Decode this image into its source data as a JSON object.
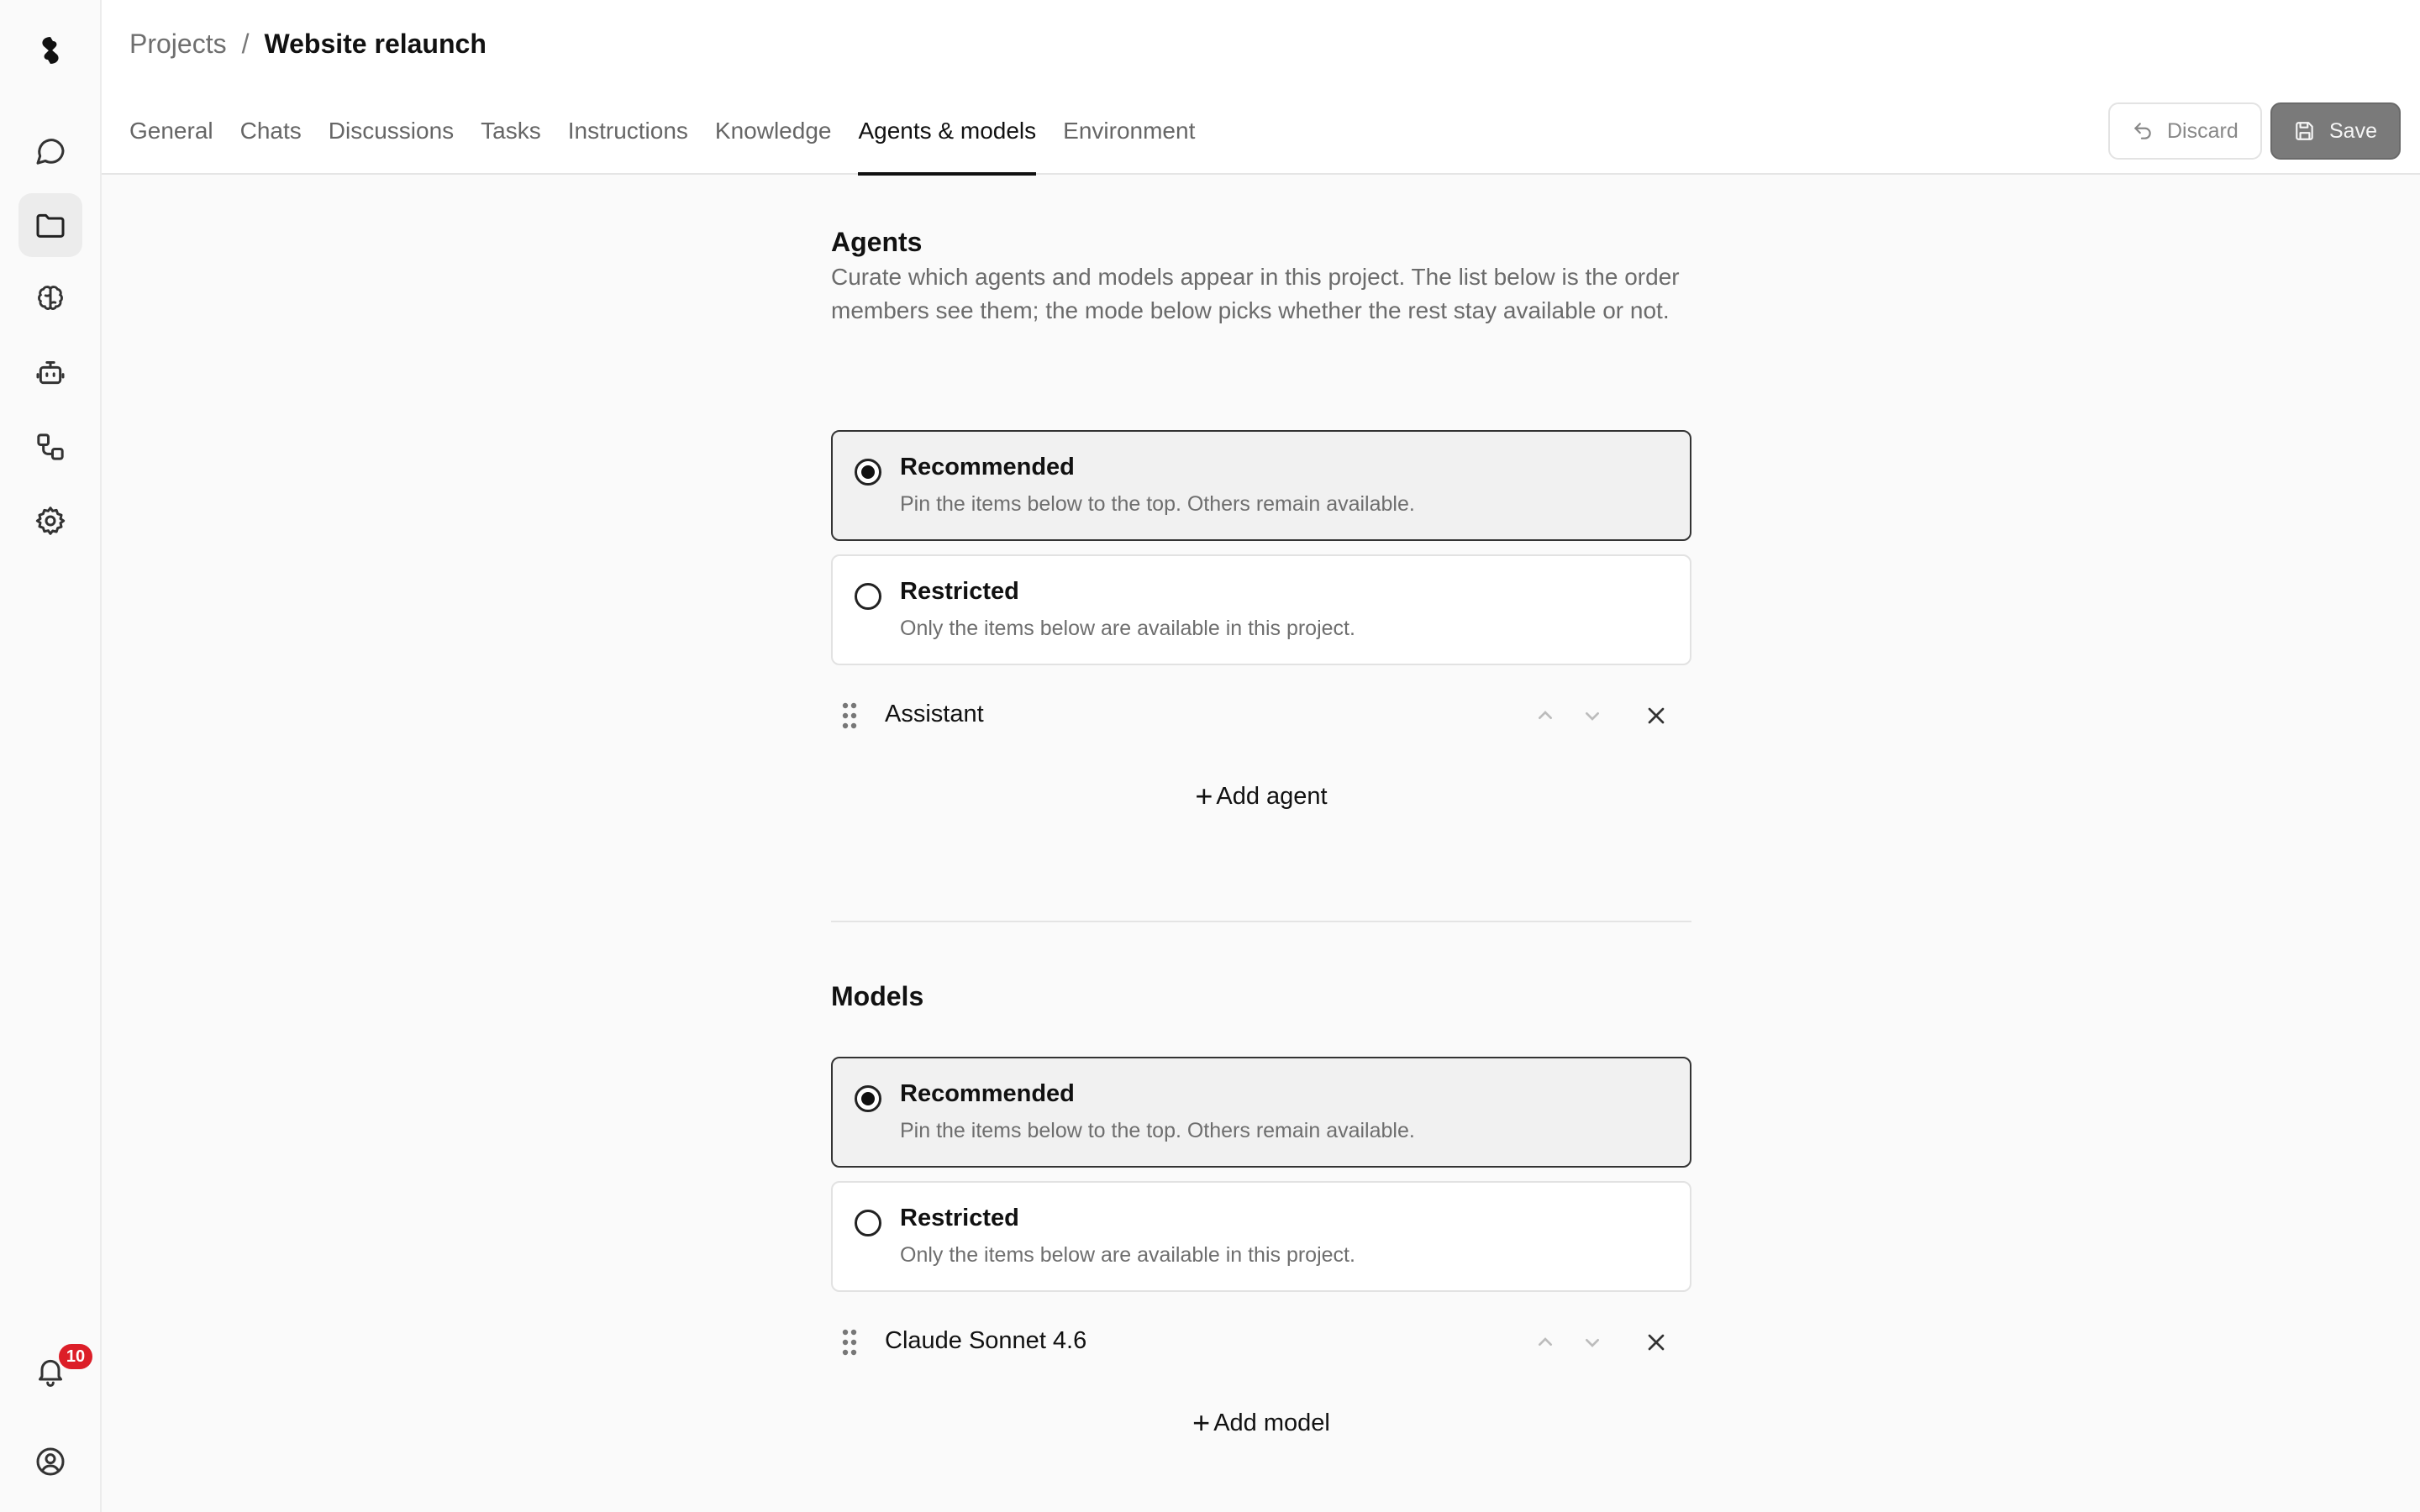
{
  "breadcrumb": {
    "parent": "Projects",
    "separator": "/",
    "current": "Website relaunch"
  },
  "tabs": [
    {
      "label": "General"
    },
    {
      "label": "Chats"
    },
    {
      "label": "Discussions"
    },
    {
      "label": "Tasks"
    },
    {
      "label": "Instructions"
    },
    {
      "label": "Knowledge"
    },
    {
      "label": "Agents & models",
      "active": true
    },
    {
      "label": "Environment"
    }
  ],
  "actions": {
    "discard": "Discard",
    "save": "Save"
  },
  "notifications": {
    "count": "10"
  },
  "agents": {
    "title": "Agents",
    "description": "Curate which agents and models appear in this project. The list below is the order members see them; the mode below picks whether the rest stay available or not.",
    "modes": [
      {
        "label": "Recommended",
        "description": "Pin the items below to the top. Others remain available.",
        "selected": true
      },
      {
        "label": "Restricted",
        "description": "Only the items below are available in this project.",
        "selected": false
      }
    ],
    "items": [
      {
        "name": "Assistant"
      }
    ],
    "add_label": "Add agent"
  },
  "models": {
    "title": "Models",
    "modes": [
      {
        "label": "Recommended",
        "description": "Pin the items below to the top. Others remain available.",
        "selected": true
      },
      {
        "label": "Restricted",
        "description": "Only the items below are available in this project.",
        "selected": false
      }
    ],
    "items": [
      {
        "name": "Claude Sonnet 4.6"
      }
    ],
    "add_label": "Add model"
  },
  "colors": {
    "accent": "#111111",
    "badge": "#dc1e28",
    "save_button": "#7a7a7a"
  }
}
